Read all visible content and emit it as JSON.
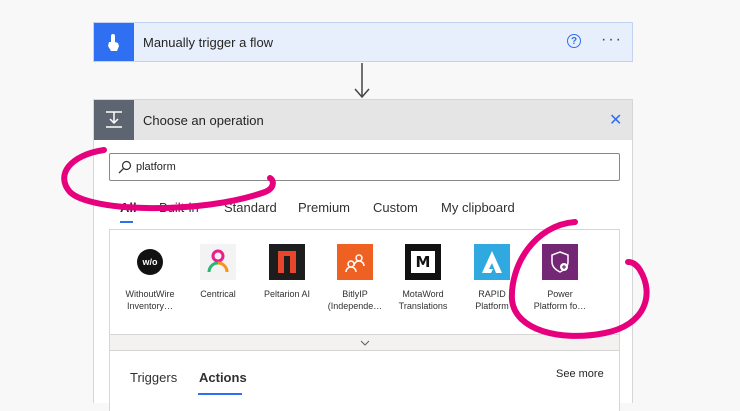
{
  "trigger": {
    "title": "Manually trigger a flow",
    "help_glyph": "?",
    "more_glyph": "···",
    "accent": "#2f6ff2"
  },
  "operation": {
    "title": "Choose an operation",
    "close_glyph": "✕",
    "search": {
      "value": "platform",
      "placeholder": ""
    },
    "tabs": [
      {
        "label": "All",
        "active": true
      },
      {
        "label": "Built-in",
        "active": false
      },
      {
        "label": "Standard",
        "active": false
      },
      {
        "label": "Premium",
        "active": false
      },
      {
        "label": "Custom",
        "active": false
      },
      {
        "label": "My clipboard",
        "active": false
      }
    ],
    "connectors": [
      {
        "line1": "WithoutWire",
        "line2": "Inventory…",
        "icon": "withoutwire-icon",
        "icon_text": "w/o",
        "bg": "#ffffff"
      },
      {
        "line1": "Centrical",
        "line2": "",
        "icon": "centrical-icon",
        "bg": "#f3f3f3"
      },
      {
        "line1": "Peltarion AI",
        "line2": "",
        "icon": "peltarion-icon",
        "bg": "#1d1d1d"
      },
      {
        "line1": "BitlyIP",
        "line2": "(Independe…",
        "icon": "bitly-icon",
        "bg": "#ee6123"
      },
      {
        "line1": "MotaWord",
        "line2": "Translations",
        "icon": "motaword-icon",
        "icon_text": "M",
        "bg": "#111111"
      },
      {
        "line1": "RAPID",
        "line2": "Platform",
        "icon": "rapid-icon",
        "bg": "#30a8e0"
      },
      {
        "line1": "Power",
        "line2": "Platform fo…",
        "icon": "power-platform-shield-icon",
        "bg": "#742774"
      }
    ],
    "subtabs": [
      {
        "label": "Triggers",
        "active": false
      },
      {
        "label": "Actions",
        "active": true
      }
    ],
    "see_more": "See more"
  },
  "annotation_color": "#e6007e"
}
